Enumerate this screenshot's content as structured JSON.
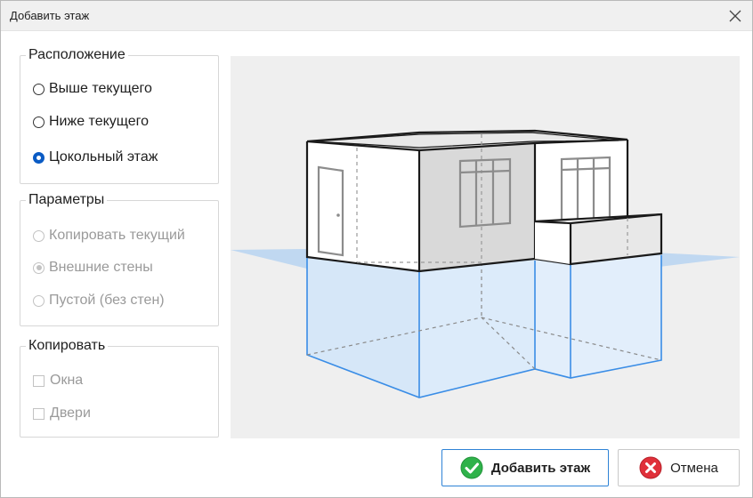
{
  "window": {
    "title": "Добавить этаж"
  },
  "location": {
    "legend": "Расположение",
    "options": [
      {
        "label": "Выше текущего",
        "checked": false
      },
      {
        "label": "Ниже текущего",
        "checked": false
      },
      {
        "label": "Цокольный этаж",
        "checked": true
      }
    ]
  },
  "params": {
    "legend": "Параметры",
    "options": [
      {
        "label": "Копировать текущий"
      },
      {
        "label": "Внешние стены"
      },
      {
        "label": "Пустой (без стен)"
      }
    ]
  },
  "copy": {
    "legend": "Копировать",
    "options": [
      {
        "label": "Окна"
      },
      {
        "label": "Двери"
      }
    ]
  },
  "buttons": {
    "add": "Добавить этаж",
    "cancel": "Отмена"
  },
  "colors": {
    "accent": "#0a5bc4",
    "basement_line": "#3a8de6",
    "ok_green": "#2fb24a",
    "cancel_red": "#e0303a"
  }
}
